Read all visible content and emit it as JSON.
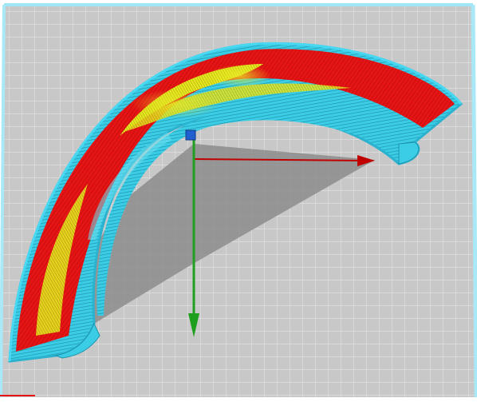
{
  "viewport": {
    "mode": "layer-view",
    "colors": {
      "background": "#ffffff",
      "build_plate": "#c7c7c7",
      "grid_line": "#e2e2e2",
      "wall_outer": "#35c9e6",
      "wall_inner": "#2aa9c4",
      "infill_red": "#e61414",
      "infill_yellow": "#e6e61e",
      "shadow": "#8a8a8a",
      "axis_x": "#c00000",
      "axis_y": "#1ea01e",
      "axis_z": "#1f5fd0"
    },
    "icons": {
      "axis_origin": "axis-origin-cube-icon",
      "x_axis": "x-axis-arrow-icon",
      "y_axis": "y-axis-arrow-icon"
    }
  }
}
